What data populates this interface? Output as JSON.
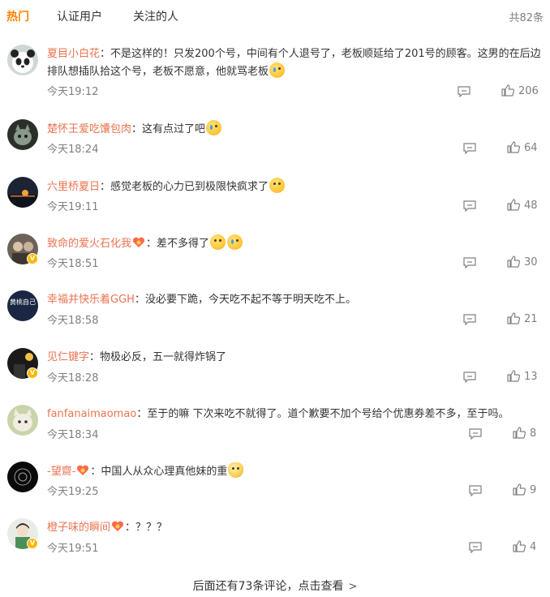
{
  "tabs": [
    {
      "label": "热门"
    },
    {
      "label": "认证用户"
    },
    {
      "label": "关注的人"
    }
  ],
  "total_count": "共82条",
  "comments": [
    {
      "user": "夏目小白花",
      "body": "：不是这样的！只发200个号，中间有个人退号了，老板顺延给了201号的顾客。这男的在后边排队想插队拾这个号，老板不愿意，他就骂老板",
      "time": "今天19:12",
      "likes": "206"
    },
    {
      "user": "楚怀王爱吃馕包肉",
      "body": "：这有点过了吧",
      "time": "今天18:24",
      "likes": "64"
    },
    {
      "user": "六里桥夏日",
      "body": "：感觉老板的心力已到极限快疯求了",
      "time": "今天19:11",
      "likes": "48"
    },
    {
      "user": "致命的爱火石化我",
      "body": "：差不多得了",
      "time": "今天18:51",
      "likes": "30"
    },
    {
      "user": "幸福并快乐着GGH",
      "body": "：没必要下跪，今天吃不起不等于明天吃不上。",
      "time": "今天18:58",
      "likes": "21"
    },
    {
      "user": "见仁键字",
      "body": "：物极必反，五一就得炸锅了",
      "time": "今天18:28",
      "likes": "13"
    },
    {
      "user": "fanfanaimaomao",
      "body": "：至于的嘛 下次来吃不就得了。道个歉要不加个号给个优惠券差不多，至于吗。",
      "time": "今天18:34",
      "likes": "8"
    },
    {
      "user": "-望齋-",
      "body": "：中国人从众心理真他妹的重",
      "time": "今天19:25",
      "likes": "9"
    },
    {
      "user": "橙子味的瞬间",
      "body": "：？？？",
      "time": "今天19:51",
      "likes": "4"
    }
  ],
  "avatar_text_5": "黄桃自己",
  "more_comments": "后面还有73条评论，点击查看",
  "colors": {
    "accent": "#ff8200",
    "username": "#eb7350",
    "meta": "#808080"
  }
}
